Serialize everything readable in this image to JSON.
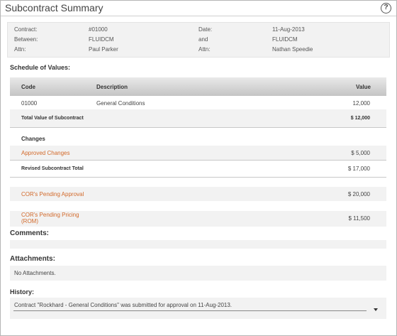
{
  "window": {
    "title": "Subcontract Summary",
    "help_label": "?"
  },
  "info": {
    "contract_label": "Contract:",
    "contract_value": "#01000",
    "date_label": "Date:",
    "date_value": "11-Aug-2013",
    "between_label": "Between:",
    "between_value": "FLUIDCM",
    "and_label": "and",
    "and_value": "FLUIDCM",
    "attn_left_label": "Attn:",
    "attn_left_value": "Paul Parker",
    "attn_right_label": "Attn:",
    "attn_right_value": "Nathan Speedie"
  },
  "schedule": {
    "heading": "Schedule of Values:",
    "columns": {
      "code": "Code",
      "description": "Description",
      "value": "Value"
    },
    "rows": [
      {
        "code": "01000",
        "description": "General Conditions",
        "value": "12,000"
      }
    ],
    "total_label": "Total Value of Subcontract",
    "total_value": "$ 12,000",
    "changes_heading": "Changes",
    "approved_label": "Approved Changes",
    "approved_value": "$ 5,000",
    "revised_label": "Revised Subcontract Total",
    "revised_value": "$ 17,000",
    "pending_approval_label": "COR's Pending Approval",
    "pending_approval_value": "$ 20,000",
    "pending_pricing_label_line1": "COR's Pending Pricing",
    "pending_pricing_label_line2": "(ROM)",
    "pending_pricing_value": "$ 11,500"
  },
  "comments": {
    "heading": "Comments:"
  },
  "attachments": {
    "heading": "Attachments:",
    "empty_text": "No Attachments."
  },
  "history": {
    "heading": "History:",
    "entry": "Contract \"Rockhard - General Conditions\" was submitted for approval on 11-Aug-2013."
  },
  "colors": {
    "accent_link": "#d2692a",
    "header_gradient_top": "#e9e9e9",
    "header_gradient_bottom": "#c4c4c4",
    "panel_bg": "#f2f2f2"
  },
  "icons": {
    "help": "question-circle-icon",
    "dropdown": "caret-down-icon"
  }
}
